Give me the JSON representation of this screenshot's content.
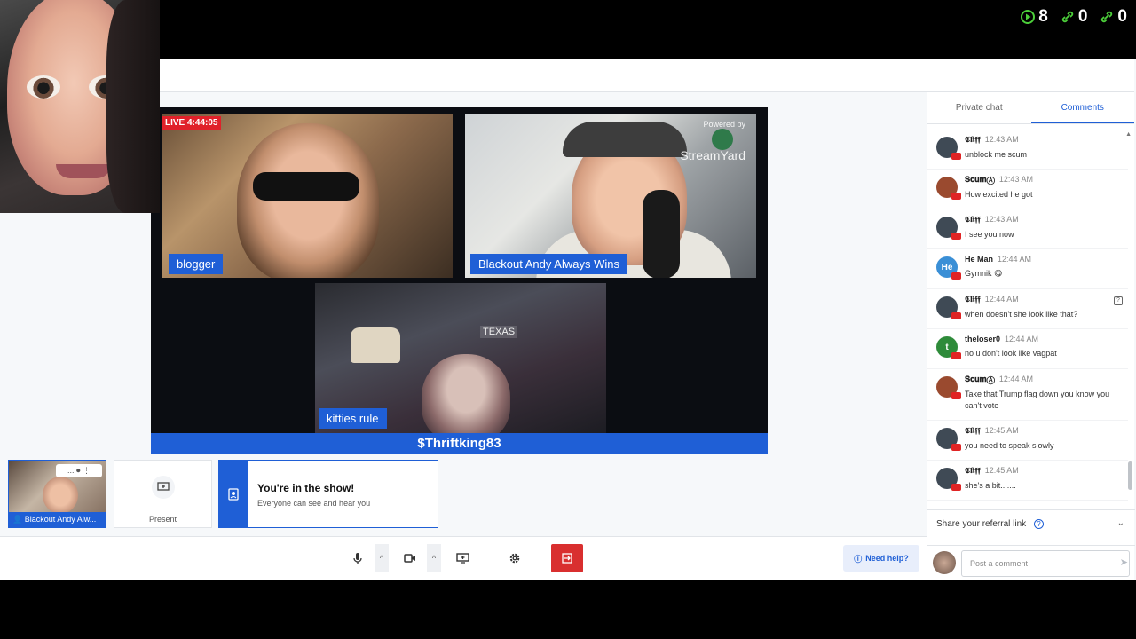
{
  "top_stats": {
    "viewers": "8",
    "links_a": "0",
    "links_b": "0"
  },
  "broadcast": {
    "live_badge": "LIVE 4:44:05",
    "powered_by": "Powered by",
    "brand": "StreamYard",
    "participants": [
      {
        "name": "blogger"
      },
      {
        "name": "Blackout Andy Always Wins"
      },
      {
        "name": "kitties rule"
      }
    ],
    "scene_text": "TEXAS",
    "banner": "$Thriftking83"
  },
  "backstage": {
    "self_name": "Blackout Andy Alw...",
    "self_controls": "... ⏺ ⋮",
    "present_label": "Present",
    "in_show_title": "You're in the show!",
    "in_show_sub": "Everyone can see and hear you"
  },
  "toolbar": {
    "help_label": "Need help?"
  },
  "panel": {
    "tabs": [
      {
        "label": "Private chat"
      },
      {
        "label": "Comments"
      }
    ],
    "comments": [
      {
        "author": "𝕮𝖑𝖎𝖋𝖋",
        "time": "12:43 AM",
        "text": "unblock me scum",
        "avatar_color": "#3f4a55",
        "initials": ""
      },
      {
        "author": "𝐒𝐜𝐮𝐦Ⓐ",
        "time": "12:43 AM",
        "text": "How excited he got",
        "avatar_color": "#9a4a2f",
        "initials": ""
      },
      {
        "author": "𝕮𝖑𝖎𝖋𝖋",
        "time": "12:43 AM",
        "text": "I see you now",
        "avatar_color": "#3f4a55",
        "initials": ""
      },
      {
        "author": "He Man",
        "time": "12:44 AM",
        "text": "Gymnik 😋",
        "avatar_color": "#3a8fd6",
        "initials": "He"
      },
      {
        "author": "𝕮𝖑𝖎𝖋𝖋",
        "time": "12:44 AM",
        "text": "when doesn't she look like that?",
        "avatar_color": "#3f4a55",
        "initials": ""
      },
      {
        "author": "theloser0",
        "time": "12:44 AM",
        "text": "no u don't look like vagpat",
        "avatar_color": "#2e8b3a",
        "initials": "t"
      },
      {
        "author": "𝐒𝐜𝐮𝐦Ⓐ",
        "time": "12:44 AM",
        "text": "Take that Trump flag down you know you can't vote",
        "avatar_color": "#9a4a2f",
        "initials": ""
      },
      {
        "author": "𝕮𝖑𝖎𝖋𝖋",
        "time": "12:45 AM",
        "text": "you need to speak slowly",
        "avatar_color": "#3f4a55",
        "initials": ""
      },
      {
        "author": "𝕮𝖑𝖎𝖋𝖋",
        "time": "12:45 AM",
        "text": "she's a bit.......",
        "avatar_color": "#3f4a55",
        "initials": ""
      }
    ],
    "referral_label": "Share your referral link",
    "post_placeholder": "Post a comment"
  }
}
